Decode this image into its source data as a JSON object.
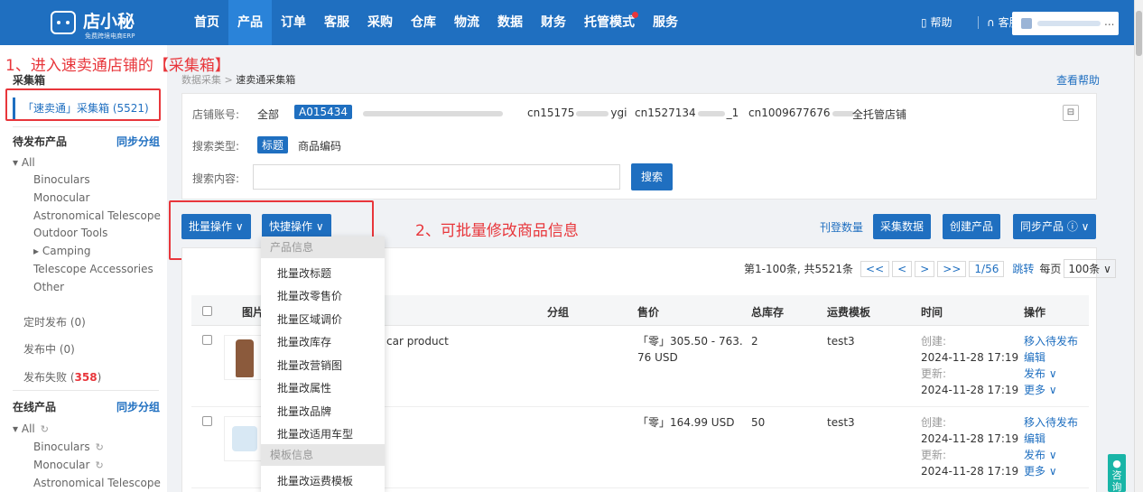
{
  "logo": {
    "name": "店小秘",
    "sub": "免费跨境电商ERP"
  },
  "nav": {
    "items": [
      "首页",
      "产品",
      "订单",
      "客服",
      "采购",
      "仓库",
      "物流",
      "数据",
      "财务",
      "托管模式",
      "服务"
    ],
    "help": "帮助",
    "kefu": "客服",
    "user_more": "..."
  },
  "annotations": {
    "step1": "1、进入速卖通店铺的【采集箱】",
    "step2": "2、可批量修改商品信息"
  },
  "sidebar": {
    "collect_title": "采集箱",
    "collect_selected": "「速卖通」采集箱 (5521)",
    "pending_title": "待发布产品",
    "pending_sync": "同步分组",
    "pending_tree": [
      "All",
      "Binoculars",
      "Monocular",
      "Astronomical Telescope",
      "Outdoor Tools",
      "Camping",
      "Telescope Accessories",
      "Other"
    ],
    "scheduled": "定时发布 (0)",
    "publishing": "发布中 (0)",
    "failed_label": "发布失败 (",
    "failed_count": "358",
    "failed_close": ")",
    "online_title": "在线产品",
    "online_sync": "同步分组",
    "online_tree": [
      "All",
      "Binoculars",
      "Monocular",
      "Astronomical Telescope"
    ]
  },
  "breadcrumb": {
    "parent": "数据采集",
    "sep": ">",
    "current": "速卖通采集箱"
  },
  "help_right": "查看帮助",
  "filter": {
    "shop_label": "店铺账号:",
    "shop_all": "全部",
    "shop_selected": "A015434",
    "shop_2": "cn15175",
    "shop_2_tail": "ygi",
    "shop_3": "cn1527134",
    "shop_3_tail": "_1",
    "shop_4": "cn1009677676",
    "shop_5": "全托管店铺",
    "type_label": "搜索类型:",
    "type_selected": "标题",
    "type_other": "商品编码",
    "content_label": "搜索内容:",
    "search_button": "搜索"
  },
  "actions": {
    "batch": "批量操作 ∨",
    "quick": "快捷操作 ∨",
    "listing_count": "刊登数量",
    "collect": "采集数据",
    "create": "创建产品",
    "sync": "同步产品 ⓘ ∨"
  },
  "pager": {
    "info": "第1-100条, 共5521条",
    "first": "<<",
    "prev": "<",
    "next": ">",
    "last": ">>",
    "page": "1/56",
    "jump": "跳转",
    "per_label": "每页",
    "per_value": "100条 ∨"
  },
  "table": {
    "headers": {
      "img": "图片",
      "group": "分组",
      "price": "售价",
      "stock": "总库存",
      "template": "运费模板",
      "time": "时间",
      "op": "操作"
    },
    "rows": [
      {
        "title": "car product",
        "price1": "「零」305.50 - 763.",
        "price2": "76 USD",
        "stock": "2",
        "template": "test3",
        "created_label": "创建:",
        "created": "2024-11-28 17:19",
        "updated_label": "更新:",
        "updated": "2024-11-28 17:19",
        "op1": "移入待发布",
        "op2": "编辑",
        "op3": "发布 ∨",
        "op4": "更多 ∨"
      },
      {
        "title": "",
        "price1": "「零」164.99 USD",
        "price2": "",
        "stock": "50",
        "template": "test3",
        "created_label": "创建:",
        "created": "2024-11-28 17:19",
        "updated_label": "更新:",
        "updated": "2024-11-28 17:19",
        "op1": "移入待发布",
        "op2": "编辑",
        "op3": "发布 ∨",
        "op4": "更多 ∨"
      }
    ]
  },
  "dropdown": {
    "group1": "产品信息",
    "items1": [
      "批量改标题",
      "批量改零售价",
      "批量区域调价",
      "批量改库存",
      "批量改营销图",
      "批量改属性",
      "批量改品牌",
      "批量改适用车型"
    ],
    "group2": "模板信息",
    "items2": [
      "批量改运费模板"
    ]
  },
  "consult": "咨询",
  "colors": {
    "primary": "#1f6fc0",
    "annotation": "#e8363b"
  }
}
